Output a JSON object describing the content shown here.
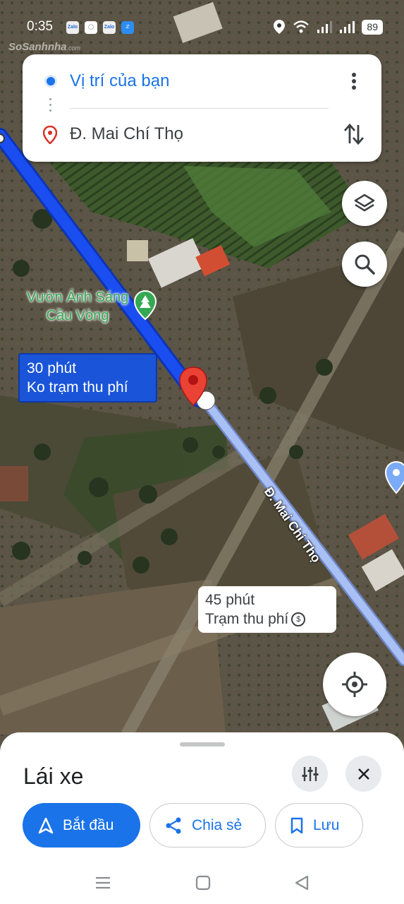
{
  "status_bar": {
    "time": "0:35",
    "apps": [
      "Zalo",
      "Zalo",
      "Zalo"
    ],
    "battery": "89",
    "watermark": "SoSanhnha",
    "watermark_suffix": ".com"
  },
  "directions": {
    "origin": "Vị trí của bạn",
    "destination": "Đ. Mai Chí Thọ",
    "icons": {
      "origin": "blue-dot-icon",
      "destination": "red-pin-icon",
      "more": "more-vert-icon",
      "swap": "swap-vertical-icon"
    }
  },
  "map": {
    "place_label": "Vườn Ánh Sáng Cầu Vòng",
    "road_label": "Đ. Mai Chí Thọ",
    "primary_route": {
      "duration": "30 phút",
      "note": "Ko trạm thu phí",
      "color": "#1a55d9"
    },
    "alt_route": {
      "duration": "45 phút",
      "note": "Trạm thu phí",
      "color": "#a9c0f5"
    },
    "buttons": {
      "layers": "layers-icon",
      "search": "search-icon",
      "locate": "my-location-icon"
    }
  },
  "sheet": {
    "mode_title": "Lái xe",
    "options_icon": "tune-icon",
    "close_icon": "close-icon",
    "actions": {
      "start": "Bắt đầu",
      "share": "Chia sẻ",
      "save": "Lưu"
    },
    "accent_color": "#1a73e8"
  },
  "navbar": {
    "icons": [
      "menu-icon",
      "home-icon",
      "back-icon"
    ]
  }
}
